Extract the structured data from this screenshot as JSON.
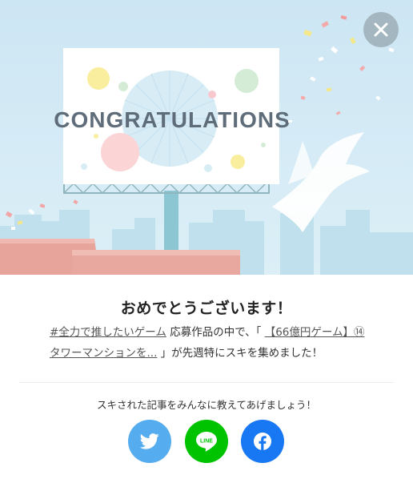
{
  "banner": {
    "billboard_text": "CONGRATULATIONS"
  },
  "modal": {
    "close_icon": "close-icon",
    "headline": "おめでとうございます！",
    "message": {
      "hashtag": "#全力で推したいゲーム",
      "text_1": " 応募作品の中で、「 ",
      "article_link": "【66億円ゲーム】⑭タワーマンションを...",
      "text_2": " 」が先週特にスキを集めました！"
    },
    "share_prompt": "スキされた記事をみんなに教えてあげましょう！",
    "share_buttons": [
      {
        "name": "twitter",
        "icon": "twitter-bird-icon",
        "color": "#55acee"
      },
      {
        "name": "line",
        "icon": "line-icon",
        "label": "LINE",
        "color": "#00c300"
      },
      {
        "name": "facebook",
        "icon": "facebook-icon",
        "color": "#1877f2"
      }
    ]
  }
}
